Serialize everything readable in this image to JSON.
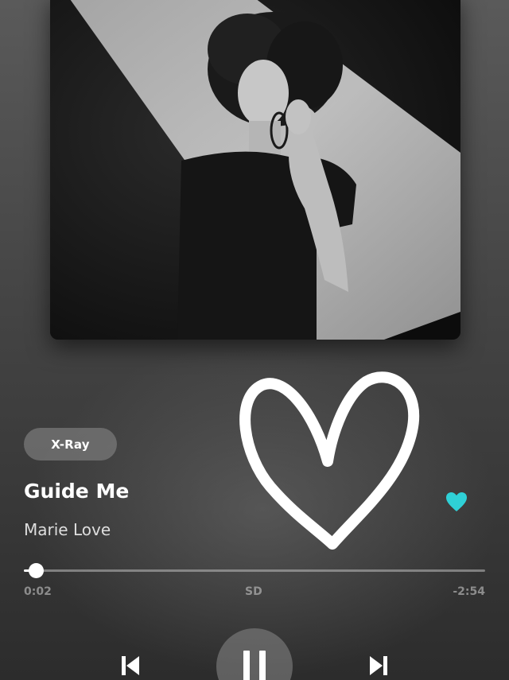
{
  "album_art": {
    "description_icon": "album-cover-photo"
  },
  "overlay": {
    "icon": "hand-drawn-heart-icon"
  },
  "track": {
    "xray_label": "X-Ray",
    "title": "Guide Me",
    "artist": "Marie Love",
    "favorite_icon": "heart-icon",
    "favorite_color": "#2fd0d6"
  },
  "playback": {
    "elapsed": "0:02",
    "quality": "SD",
    "remaining": "-2:54",
    "progress_fraction": 0.027
  },
  "controls": {
    "previous_icon": "skip-previous-icon",
    "pause_icon": "pause-icon",
    "next_icon": "skip-next-icon"
  }
}
